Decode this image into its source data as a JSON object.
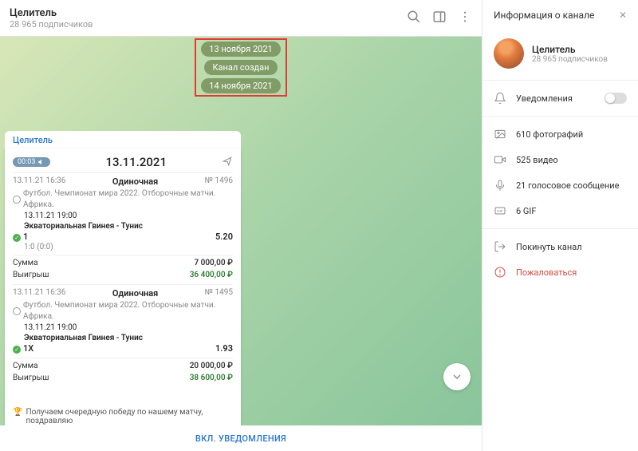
{
  "header": {
    "title": "Целитель",
    "subtitle": "28 965 подписчиков"
  },
  "chips": {
    "date1": "13 ноября 2021",
    "created": "Канал создан",
    "date2": "14 ноября 2021"
  },
  "pinned": {
    "link": "Целитель"
  },
  "msg": {
    "audio_time": "00:03",
    "big_date": "13.11.2021",
    "bets": [
      {
        "ts": "13.11.21 16:36",
        "type": "Одиночная",
        "num": "№ 1496",
        "desc": "Футбол. Чемпионат мира 2022. Отборочные матчи. Африка.",
        "when": "13.11.21 19:00",
        "teams": "Экваториальная Гвинея - Тунис",
        "pick": "1",
        "odd": "5.20",
        "score": "1:0 (0:0)",
        "sum_label": "Сумма",
        "sum_val": "7 000,00 ₽",
        "win_label": "Выигрыш",
        "win_val": "36 400,00 ₽"
      },
      {
        "ts": "13.11.21 16:36",
        "type": "Одиночная",
        "num": "№ 1495",
        "desc": "Футбол. Чемпионат мира 2022. Отборочные матчи. Африка.",
        "when": "13.11.21 19:00",
        "teams": "Экваториальная Гвинея - Тунис",
        "pick": "1X",
        "odd": "1.93",
        "score": "",
        "sum_label": "Сумма",
        "sum_val": "20 000,00 ₽",
        "win_label": "Выигрыш",
        "win_val": "38 600,00 ₽"
      }
    ],
    "truncated": "Получаем очередную победу по нашему матчу, поздравляю"
  },
  "bottom_bar": "ВКЛ. УВЕДОМЛЕНИЯ",
  "sidebar": {
    "title": "Информация о канале",
    "name": "Целитель",
    "subs": "28 965 подписчиков",
    "notif": "Уведомления",
    "media": {
      "photos": "610 фотографий",
      "videos": "525 видео",
      "voice": "21 голосовое сообщение",
      "gif": "6 GIF"
    },
    "leave": "Покинуть канал",
    "report": "Пожаловаться"
  }
}
